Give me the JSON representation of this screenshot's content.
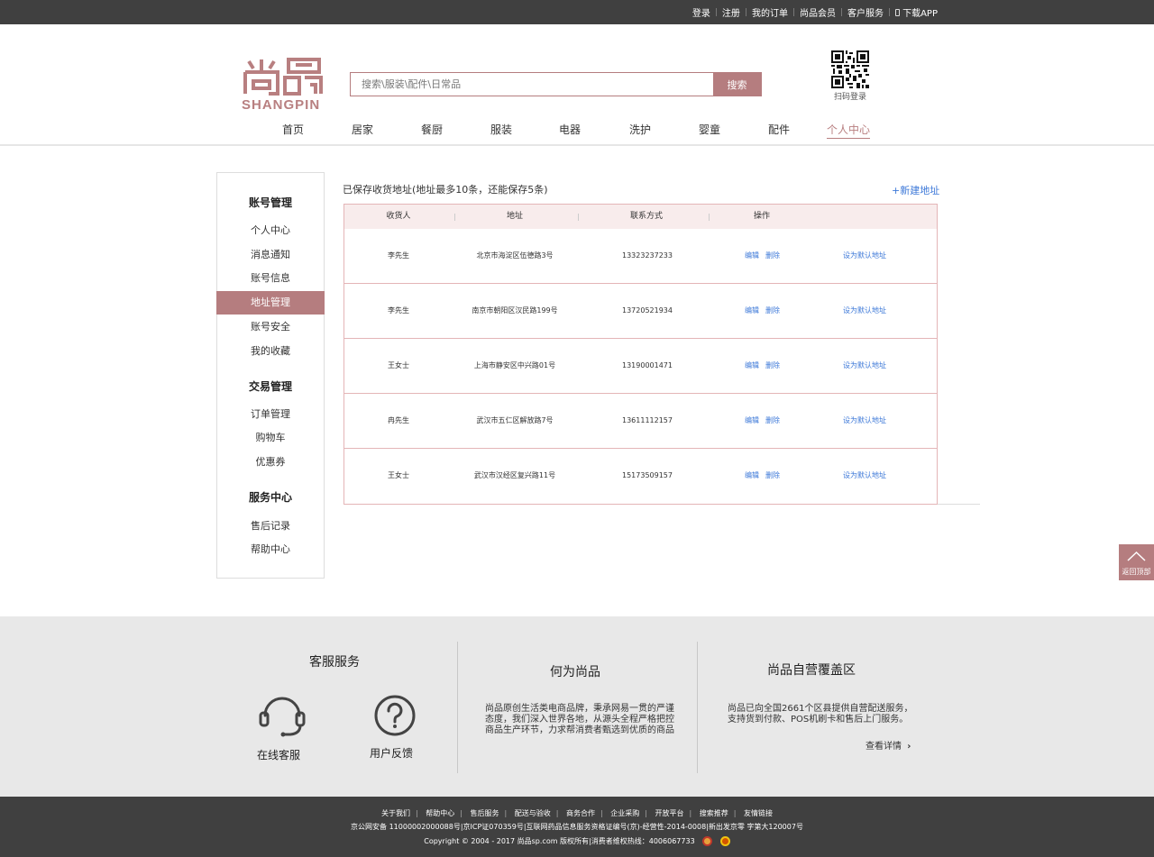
{
  "topbar": {
    "login": "登录",
    "register": "注册",
    "my_orders": "我的订单",
    "member": "尚品会员",
    "service": "客户服务",
    "download_app": "下载APP"
  },
  "logo": {
    "text": "SHANGPIN",
    "chinese": "尚品"
  },
  "search": {
    "placeholder": "搜索\\服装\\配件\\日常品",
    "button": "搜索"
  },
  "qr": {
    "label": "扫码登录"
  },
  "nav": [
    "首页",
    "居家",
    "餐厨",
    "服装",
    "电器",
    "洗护",
    "婴童",
    "配件",
    "个人中心"
  ],
  "nav_active": "个人中心",
  "sidebar": {
    "account_title": "账号管理",
    "account_items": [
      "个人中心",
      "消息通知",
      "账号信息",
      "地址管理",
      "账号安全",
      "我的收藏"
    ],
    "active_item": "地址管理",
    "trade_title": "交易管理",
    "trade_items": [
      "订单管理",
      "购物车",
      "优惠券"
    ],
    "service_title": "服务中心",
    "service_items": [
      "售后记录",
      "帮助中心"
    ]
  },
  "address": {
    "title": "已保存收货地址(地址最多10条，还能保存5条)",
    "new_button": "+新建地址",
    "headers": [
      "收货人",
      "地址",
      "联系方式",
      "操作"
    ],
    "edit": "编辑",
    "delete": "删除",
    "set_default": "设为默认地址",
    "rows": [
      {
        "name": "李先生",
        "address": "北京市海淀区伍德路3号",
        "phone": "13323237233"
      },
      {
        "name": "李先生",
        "address": "南京市朝阳区汉民路199号",
        "phone": "13720521934"
      },
      {
        "name": "王女士",
        "address": "上海市静安区中兴路01号",
        "phone": "13190001471"
      },
      {
        "name": "冉先生",
        "address": "武汉市五仁区解放路7号",
        "phone": "13611112157"
      },
      {
        "name": "王女士",
        "address": "武汉市汉经区复兴路11号",
        "phone": "15173509157"
      }
    ]
  },
  "back_to_top": "返回顶部",
  "footer": {
    "service_title": "客服服务",
    "online_service": "在线客服",
    "feedback": "用户反馈",
    "about_title": "何为尚品",
    "about_text": "尚品原创生活类电商品牌，秉承网易一贯的严谨态度，我们深入世界各地，从源头全程严格把控商品生产环节，力求帮消费者甄选到优质的商品",
    "coverage_title": "尚品自营覆盖区",
    "coverage_text": "尚品已向全国2661个区县提供自营配送服务，支持货到付款、POS机刷卡和售后上门服务。",
    "view_more": "查看详情"
  },
  "bottom": {
    "links": [
      "关于我们",
      "帮助中心",
      "售后服务",
      "配送与验收",
      "商务合作",
      "企业采购",
      "开放平台",
      "搜索推荐",
      "友情链接"
    ],
    "line2": "京公网安备 11000002000088号|京ICP证070359号|互联网药品信息服务资格证编号(京)-经营性-2014-0008|新出发京零 字第大120007号",
    "line3": "Copyright © 2004 - 2017  尚品sp.com 版权所有|消费者维权热线：4006067733"
  }
}
